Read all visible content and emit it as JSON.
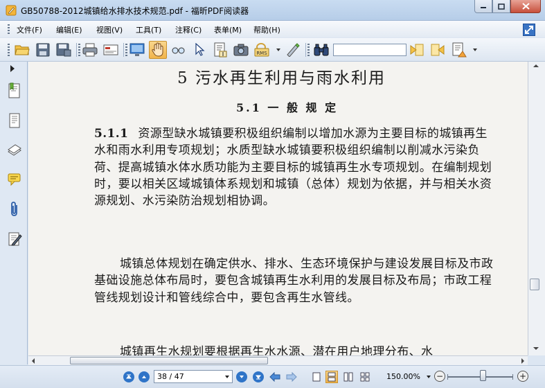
{
  "window": {
    "title": "GB50788-2012城镇给水排水技术规范.pdf - 福昕PDF阅读器"
  },
  "menu": {
    "items": [
      "文件(F)",
      "编辑(E)",
      "视图(V)",
      "工具(T)",
      "注释(C)",
      "表单(M)",
      "帮助(H)"
    ]
  },
  "toolbar": {
    "buttons": [
      "open-icon",
      "save-icon",
      "save-as-icon",
      "print-icon",
      "email-icon",
      "fullscreen-icon",
      "hand-tool-icon",
      "snapshot-zoom-icon",
      "select-arrow-icon",
      "text-select-icon",
      "snapshot-icon",
      "rms-icon",
      "typewriter-icon",
      "find-icon",
      "find-previous-icon",
      "find-next-icon",
      "highlight-search-icon"
    ],
    "active": "hand-tool-icon",
    "rms_label": "RMS",
    "search_value": ""
  },
  "sidebar": {
    "icons": [
      "bookmarks-icon",
      "pages-icon",
      "layers-icon",
      "comments-icon",
      "attachments-icon",
      "signatures-icon"
    ]
  },
  "document": {
    "chapter_heading": "5  污水再生利用与雨水利用",
    "section_heading": "5.1  一 般 规 定",
    "clause_number": "5.1.1",
    "clause_text": "资源型缺水城镇要积极组织编制以增加水源为主要目标的城镇再生水和雨水利用专项规划；水质型缺水城镇要积极组织编制以削减水污染负荷、提高城镇水体水质功能为主要目标的城镇再生水专项规划。在编制规划时，要以相关区域城镇体系规划和城镇（总体）规划为依据，并与相关水资源规划、水污染防治规划相协调。",
    "para2": "城镇总体规划在确定供水、排水、生态环境保护与建设发展目标及市政基础设施总体布局时，要包含城镇再生水利用的发展目标及布局；市政工程管线规划设计和管线综合中，要包含再生水管线。",
    "para3_partial": "城镇再生水规划要根据再生水水源、潜在用户地理分布、水"
  },
  "statusbar": {
    "page_display": "38 / 47",
    "current_page": 38,
    "total_pages": 47,
    "zoom": "150.00%",
    "zoom_slider_fraction": 0.55
  },
  "colors": {
    "chrome_bg": "#dce6f2",
    "active_tool": "#f1b44b",
    "page_bg": "#f4f3f0"
  }
}
